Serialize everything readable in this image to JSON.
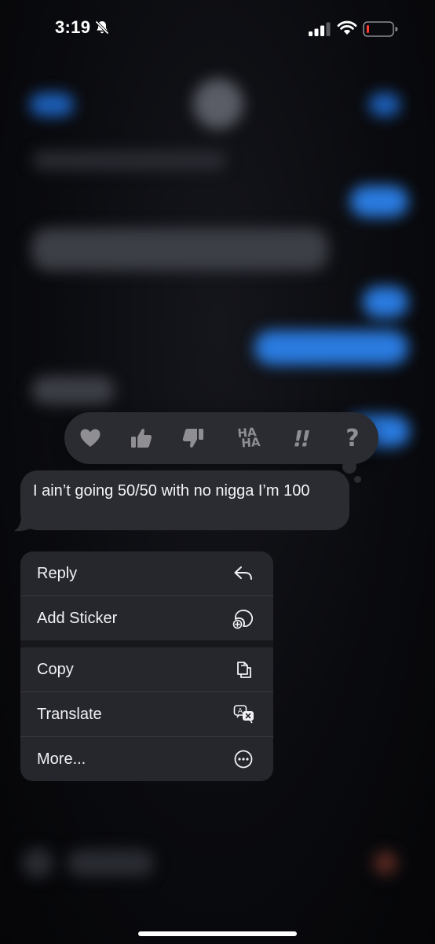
{
  "status_bar": {
    "time": "3:19"
  },
  "tapbacks": [
    {
      "name": "heart",
      "icon": "heart-icon"
    },
    {
      "name": "thumbs-up",
      "icon": "thumbs-up-icon"
    },
    {
      "name": "thumbs-down",
      "icon": "thumbs-down-icon"
    },
    {
      "name": "haha",
      "icon": "haha-icon",
      "line1": "HA",
      "line2": "HA"
    },
    {
      "name": "emphasize",
      "icon": "double-exclamation-icon",
      "glyph": "!!"
    },
    {
      "name": "question",
      "icon": "question-icon",
      "glyph": "?"
    }
  ],
  "message": {
    "text": "I ain’t going 50/50 with no nigga I’m 100"
  },
  "context_menu": {
    "reply": {
      "label": "Reply",
      "icon": "reply-arrow-icon"
    },
    "add_sticker": {
      "label": "Add Sticker",
      "icon": "sticker-add-icon"
    },
    "copy": {
      "label": "Copy",
      "icon": "copy-icon"
    },
    "translate": {
      "label": "Translate",
      "icon": "translate-icon"
    },
    "more": {
      "label": "More...",
      "icon": "ellipsis-circle-icon"
    }
  },
  "colors": {
    "background": "#050507",
    "bubble": "#2b2c31",
    "menu": "#26272c",
    "tapback_icon": "#8e8e93",
    "battery_low": "#ff3b30",
    "blurred_blue": "#2a7be0"
  }
}
